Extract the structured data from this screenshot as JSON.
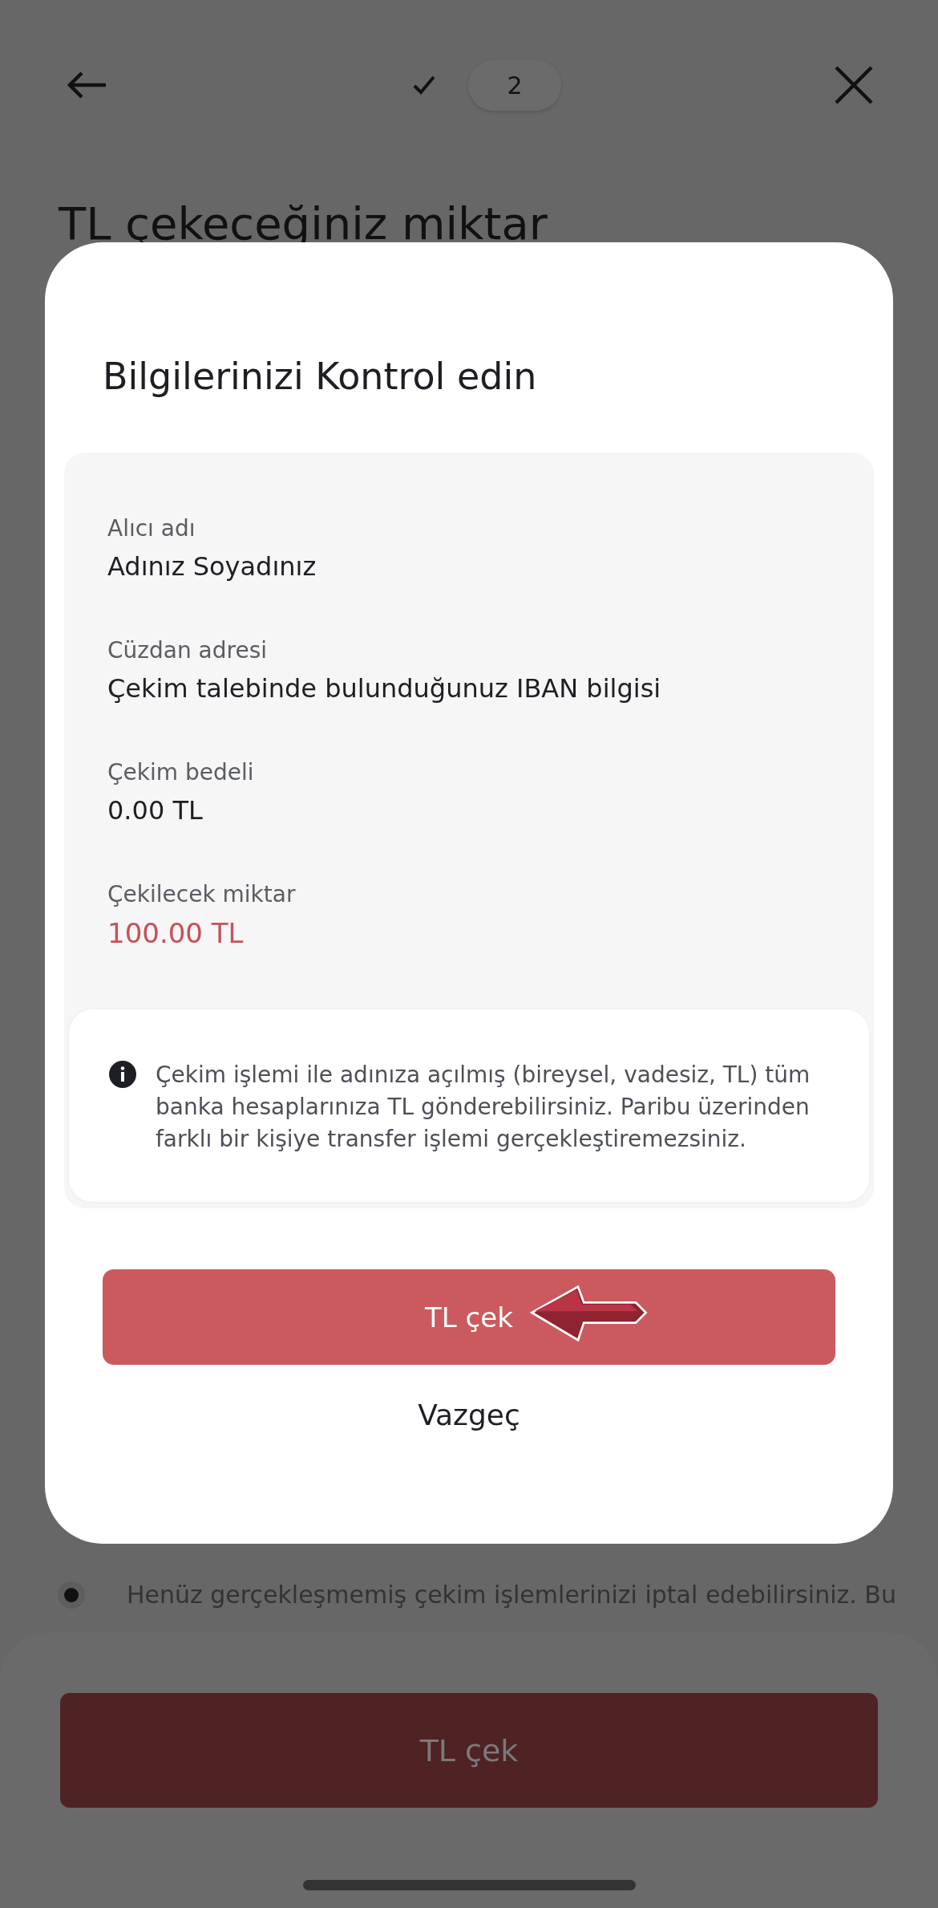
{
  "stepper": [
    {
      "kind": "done"
    },
    {
      "kind": "current",
      "label": "2"
    }
  ],
  "page_title": "TL çekeceğiniz miktar",
  "bullets": [
    {
      "text": "Henüz gerçekleşmemiş çekim işlemlerinizi iptal edebilirsiniz. Bu"
    }
  ],
  "bottom_button": {
    "label": "TL çek"
  },
  "modal": {
    "title": "Bilgilerinizi Kontrol edin",
    "fields": [
      {
        "label": "Alıcı adı",
        "value": "Adınız Soyadınız",
        "emphasis": false
      },
      {
        "label": "Cüzdan adresi",
        "value": "Çekim talebinde bulunduğunuz IBAN bilgisi",
        "emphasis": false
      },
      {
        "label": "Çekim bedeli",
        "value": "0.00 TL",
        "emphasis": false
      },
      {
        "label": "Çekilecek miktar",
        "value": "100.00 TL",
        "emphasis": true
      }
    ],
    "info": "Çekim işlemi ile adınıza açılmış (bireysel, vadesiz, TL) tüm banka hesaplarınıza TL gönderebilirsiniz. Paribu üzerinden farklı bir kişiye transfer işlemi gerçekleştiremezsiniz.",
    "confirm_button": "TL çek",
    "cancel_button": "Vazgeç"
  }
}
